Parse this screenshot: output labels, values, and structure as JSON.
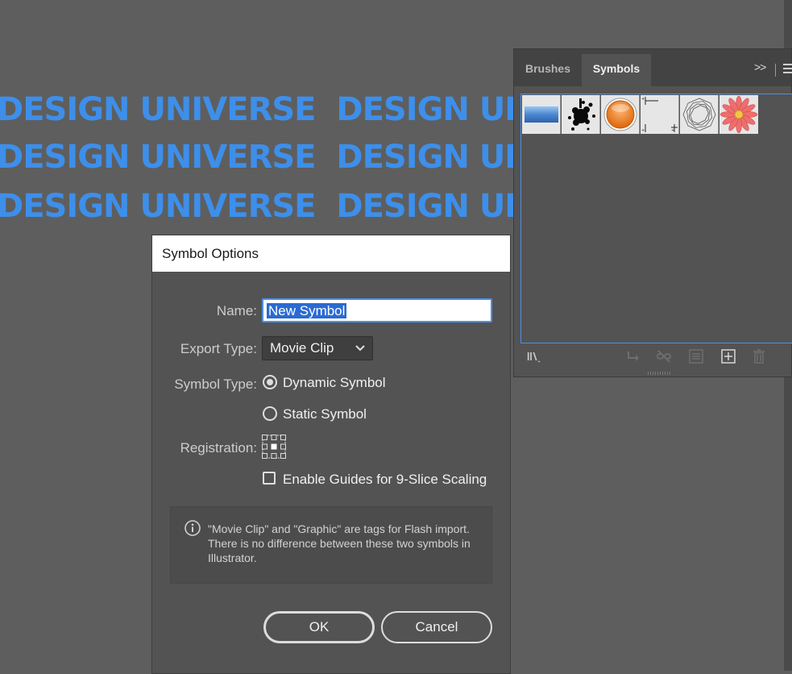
{
  "artwork": {
    "lines": [
      "DESIGN UNIVERSE  DESIGN UNIVERSE",
      "DESIGN UNIVERSE  DESIGN UNIVERSE",
      "DESIGN UNIVERSE  DESIGN UNIVERSE"
    ]
  },
  "panel": {
    "tabs": [
      {
        "label": "Brushes",
        "active": false
      },
      {
        "label": "Symbols",
        "active": true
      }
    ],
    "overflow_label": ">>",
    "symbols": [
      {
        "name": "blue-gradient-banner-icon"
      },
      {
        "name": "ink-splatter-icon"
      },
      {
        "name": "orange-button-icon"
      },
      {
        "name": "crop-marks-icon"
      },
      {
        "name": "wire-ring-icon"
      },
      {
        "name": "daisy-flower-icon"
      }
    ],
    "footer_icons": [
      "symbol-libraries-icon",
      "place-symbol-instance-icon",
      "break-link-icon",
      "symbol-options-icon",
      "new-symbol-icon",
      "delete-symbol-icon"
    ]
  },
  "dialog": {
    "title": "Symbol Options",
    "name_label": "Name:",
    "name_value": "New Symbol",
    "export_type_label": "Export Type:",
    "export_type_value": "Movie Clip",
    "symbol_type_label": "Symbol Type:",
    "symbol_type_options": [
      {
        "label": "Dynamic Symbol",
        "checked": true
      },
      {
        "label": "Static Symbol",
        "checked": false
      }
    ],
    "registration_label": "Registration:",
    "nine_slice_label": "Enable Guides for 9-Slice Scaling",
    "nine_slice_checked": false,
    "info_text": "\"Movie Clip\" and \"Graphic\" are tags for Flash import. There is no difference between these two symbols in Illustrator.",
    "ok_label": "OK",
    "cancel_label": "Cancel"
  },
  "colors": {
    "artwork_text": "#3d8fea",
    "focus_accent": "#4b8fe8",
    "selection": "#2a6ad2",
    "canvas": "#5e5e5e",
    "panel": "#535353"
  }
}
